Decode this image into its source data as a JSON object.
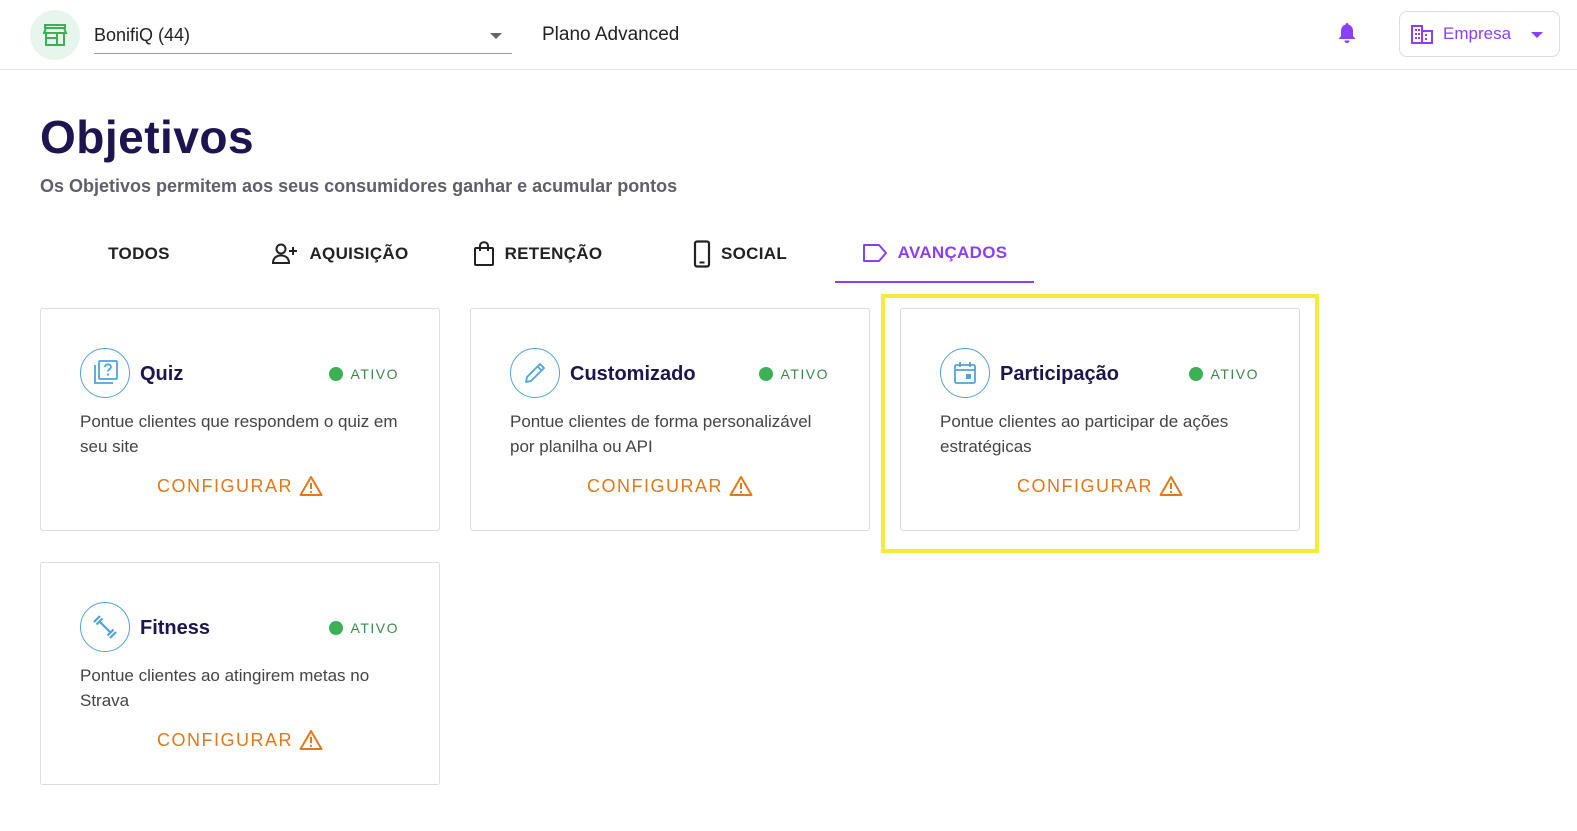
{
  "topbar": {
    "store_name": "BonifiQ (44)",
    "plan": "Plano Advanced",
    "company_label": "Empresa"
  },
  "header": {
    "title": "Objetivos",
    "subtitle": "Os Objetivos permitem aos seus consumidores ganhar e acumular pontos"
  },
  "tabs": [
    {
      "label": "TODOS",
      "icon": null,
      "active": false
    },
    {
      "label": "AQUISIÇÃO",
      "icon": "add-person-icon",
      "active": false
    },
    {
      "label": "RETENÇÃO",
      "icon": "shopping-bag-icon",
      "active": false
    },
    {
      "label": "SOCIAL",
      "icon": "smartphone-icon",
      "active": false
    },
    {
      "label": "AVANÇADOS",
      "icon": "label-tag-icon",
      "active": true
    }
  ],
  "cards": [
    {
      "title": "Quiz",
      "status": "ATIVO",
      "description": "Pontue clientes que respondem o quiz em seu site",
      "action": "CONFIGURAR",
      "icon": "quiz-icon"
    },
    {
      "title": "Customizado",
      "status": "ATIVO",
      "description": "Pontue clientes de forma personalizável por planilha ou API",
      "action": "CONFIGURAR",
      "icon": "pencil-icon"
    },
    {
      "title": "Participação",
      "status": "ATIVO",
      "description": "Pontue clientes ao participar de ações estratégicas",
      "action": "CONFIGURAR",
      "icon": "calendar-icon"
    },
    {
      "title": "Fitness",
      "status": "ATIVO",
      "description": "Pontue clientes ao atingirem metas no Strava",
      "action": "CONFIGURAR",
      "icon": "dumbbell-icon"
    }
  ],
  "colors": {
    "accent": "#8a3ffc",
    "title": "#1e1450",
    "status_green": "#3cb054",
    "action_orange": "#e57717",
    "icon_blue": "#4fa3e0",
    "highlight": "#f8ea3c"
  }
}
